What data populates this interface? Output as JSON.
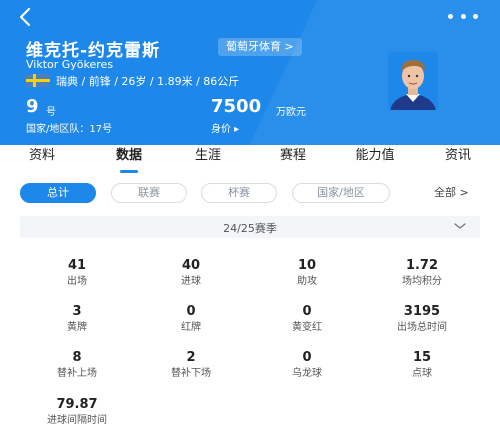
{
  "header": {
    "name_cn": "维克托-约克雷斯",
    "club_tag": "葡萄牙体育 >",
    "name_en": "Viktor Gyökeres",
    "info_line": "瑞典 / 前锋 / 26岁 / 1.89米 / 86公斤",
    "shirt_number": "9",
    "shirt_unit": "号",
    "national_team_line": "国家/地区队：17号",
    "market_value": "7500",
    "market_value_unit": "万欧元",
    "market_value_label": "身价 ▸"
  },
  "tabs": [
    "资料",
    "数据",
    "生涯",
    "赛程",
    "能力值",
    "资讯"
  ],
  "active_tab": "数据",
  "filters": {
    "chips": [
      "总计",
      "联赛",
      "杯赛",
      "国家/地区"
    ],
    "active": "总计",
    "all_label": "全部 >"
  },
  "season": {
    "label": "24/25赛季"
  },
  "stats": [
    {
      "value": "41",
      "label": "出场"
    },
    {
      "value": "40",
      "label": "进球"
    },
    {
      "value": "10",
      "label": "助攻"
    },
    {
      "value": "1.72",
      "label": "场均积分"
    },
    {
      "value": "3",
      "label": "黄牌"
    },
    {
      "value": "0",
      "label": "红牌"
    },
    {
      "value": "0",
      "label": "黄变红"
    },
    {
      "value": "3195",
      "label": "出场总时间"
    },
    {
      "value": "8",
      "label": "替补上场"
    },
    {
      "value": "2",
      "label": "替补下场"
    },
    {
      "value": "0",
      "label": "乌龙球"
    },
    {
      "value": "15",
      "label": "点球"
    },
    {
      "value": "79.87",
      "label": "进球间隔时间"
    }
  ],
  "colors": {
    "brand_blue": "#1d88ea",
    "text_dark": "#222222",
    "text_muted": "#8a93a0"
  },
  "icons": {
    "back": "back-arrow-icon",
    "more": "more-dots-icon",
    "season_toggle": "chevron-down-icon"
  }
}
